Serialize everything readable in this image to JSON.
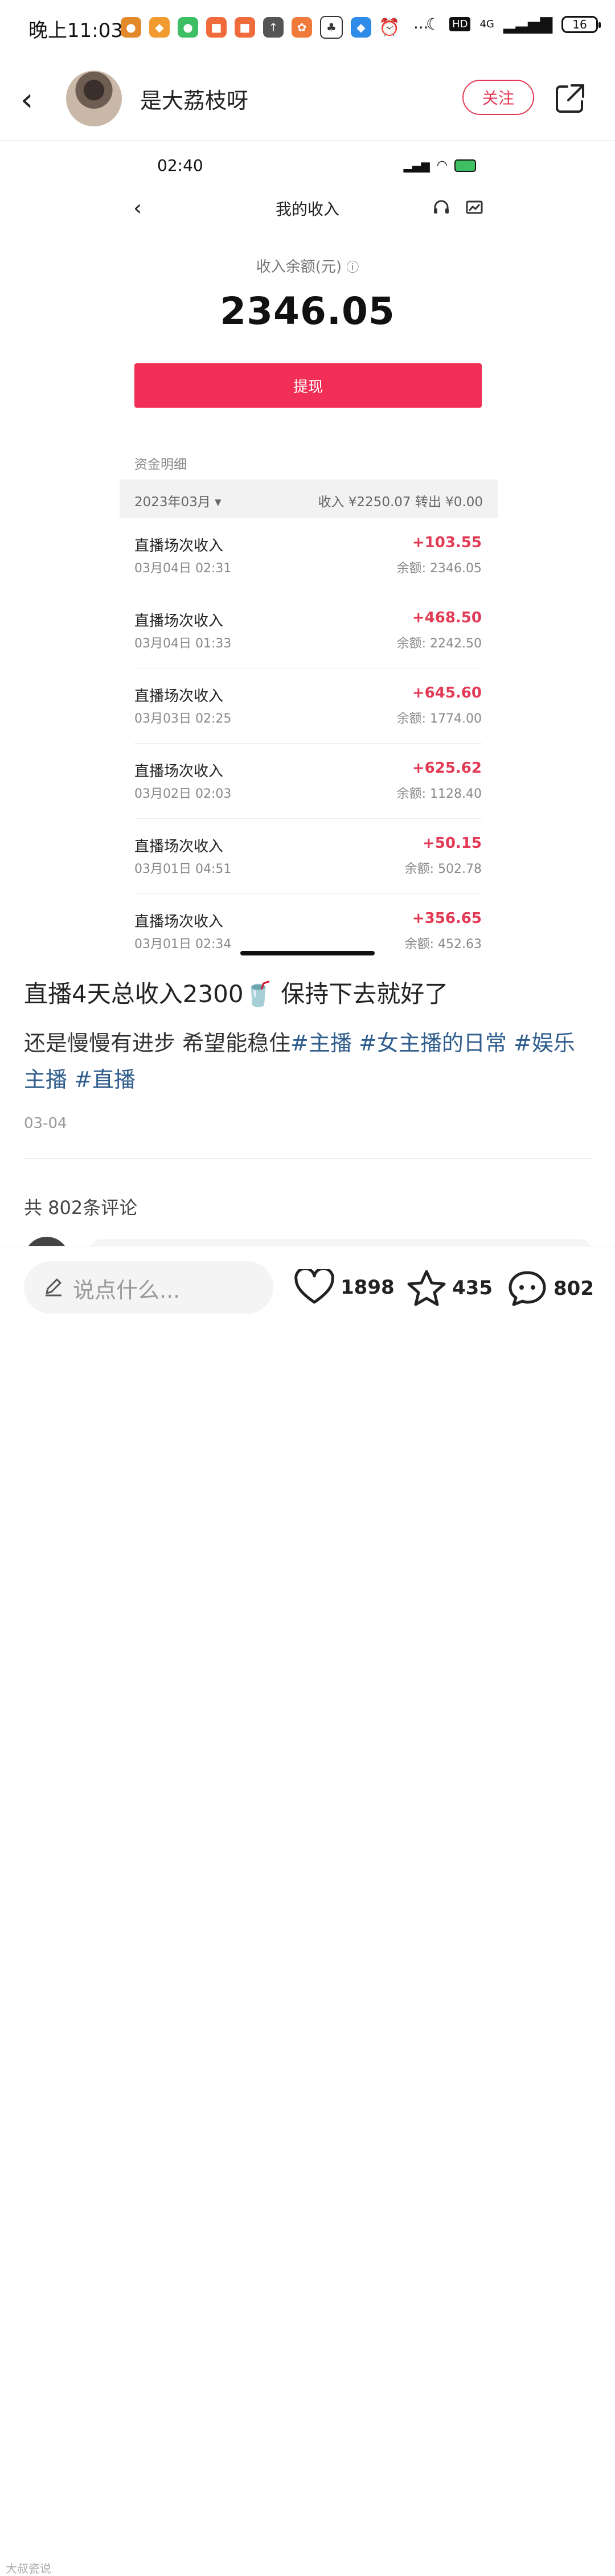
{
  "status_bar": {
    "time": "晚上11:03",
    "network": "4G",
    "hd": "HD",
    "battery": "16",
    "more": "···"
  },
  "header": {
    "author_name": "是大荔枝呀",
    "follow_label": "关注"
  },
  "screenshot": {
    "status_time": "02:40",
    "title": "我的收入",
    "balance_label": "收入余额(元)",
    "balance_amount": "2346.05",
    "withdraw_label": "提现",
    "detail_label": "资金明细",
    "month": "2023年03月 ▾",
    "month_summary": "收入 ¥2250.07   转出 ¥0.00",
    "rows": [
      {
        "title": "直播场次收入",
        "date": "03月04日 02:31",
        "amount": "+103.55",
        "balance": "余额: 2346.05"
      },
      {
        "title": "直播场次收入",
        "date": "03月04日 01:33",
        "amount": "+468.50",
        "balance": "余额: 2242.50"
      },
      {
        "title": "直播场次收入",
        "date": "03月03日 02:25",
        "amount": "+645.60",
        "balance": "余额: 1774.00"
      },
      {
        "title": "直播场次收入",
        "date": "03月02日 02:03",
        "amount": "+625.62",
        "balance": "余额: 1128.40"
      },
      {
        "title": "直播场次收入",
        "date": "03月01日 04:51",
        "amount": "+50.15",
        "balance": "余额: 502.78"
      },
      {
        "title": "直播场次收入",
        "date": "03月01日 02:34",
        "amount": "+356.65",
        "balance": "余额: 452.63"
      }
    ]
  },
  "post": {
    "title": "直播4天总收入2300🥤 保持下去就好了",
    "body_text": "还是慢慢有进步 希望能稳住",
    "tags": [
      "#主播",
      "#女主播的日常",
      "#娱乐主播",
      "#直播"
    ],
    "date": "03-04",
    "comments_count": "共 802条评论"
  },
  "bottom_bar": {
    "input_placeholder": "说点什么...",
    "likes": "1898",
    "favorites": "435",
    "comments": "802"
  },
  "watermark": "大叔瓷说",
  "colors": {
    "accent": "#f12e56",
    "tag": "#2f5d8c"
  }
}
